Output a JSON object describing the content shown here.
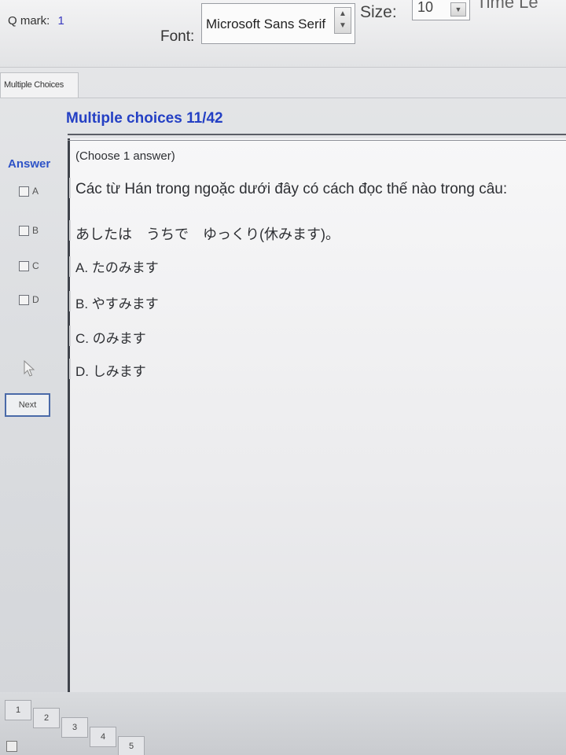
{
  "toolbar": {
    "qmark_label": "Q mark:",
    "qmark_value": "1",
    "font_label": "Font:",
    "font_value": "Microsoft Sans Serif",
    "size_label": "Size:",
    "size_value": "10",
    "cut_label": "Time Le"
  },
  "tab": {
    "label": "Multiple Choices"
  },
  "title": "Multiple choices 11/42",
  "answer_label": "Answer",
  "answer_options": [
    {
      "letter": "A"
    },
    {
      "letter": "B"
    },
    {
      "letter": "C"
    },
    {
      "letter": "D"
    }
  ],
  "next_label": "Next",
  "question": {
    "note": "(Choose 1 answer)",
    "prompt": "Các từ Hán trong ngoặc dưới đây có cách đọc thế nào trong câu:",
    "sentence": "あしたは　うちで　ゆっくり(休みます)。",
    "options": [
      "A. たのみます",
      "B. やすみます",
      "C. のみます",
      "D. しみます"
    ]
  },
  "pages": [
    "1",
    "2",
    "3",
    "4",
    "5"
  ],
  "colors": {
    "accent_blue": "#2440c4",
    "answer_blue": "#2e53c7",
    "panel_border": "#3f434b",
    "next_border": "#4a6aa8"
  },
  "icons": {
    "spinner": "up-down-arrows-icon",
    "dropdown": "chevron-down-icon",
    "cursor": "mouse-pointer-icon"
  }
}
